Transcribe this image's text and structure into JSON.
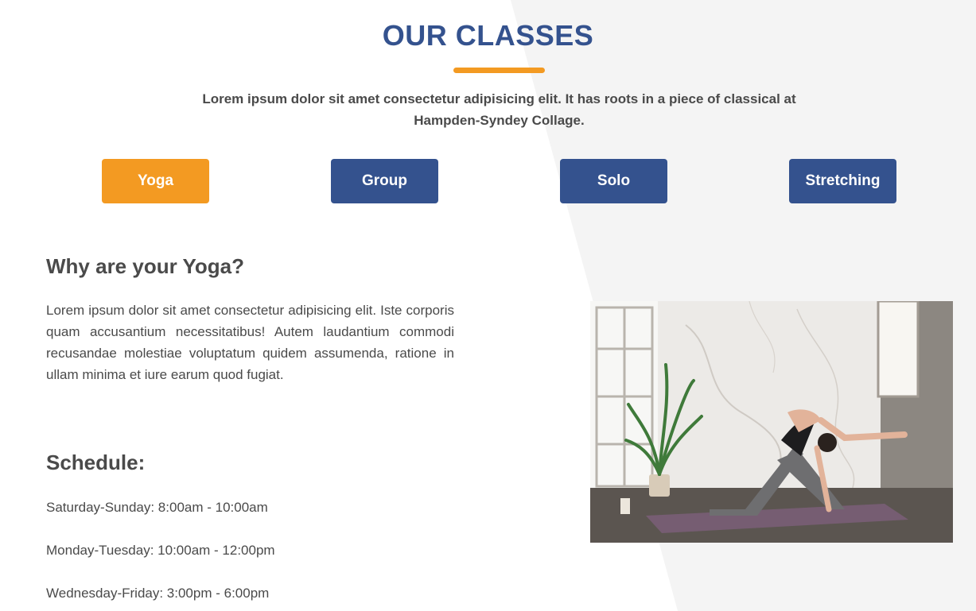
{
  "section": {
    "title": "OUR CLASSES",
    "intro": "Lorem ipsum dolor sit amet consectetur adipisicing elit. It has roots in a piece of classical at Hampden-Syndey Collage."
  },
  "tabs": [
    {
      "label": "Yoga",
      "active": true
    },
    {
      "label": "Group",
      "active": false
    },
    {
      "label": "Solo",
      "active": false
    },
    {
      "label": "Stretching",
      "active": false
    }
  ],
  "detail": {
    "heading": "Why are your Yoga?",
    "paragraph": "Lorem ipsum dolor sit amet consectetur adipisicing elit. Iste corporis quam accusantium necessitatibus! Autem laudantium commodi recusandae molestiae voluptatum quidem assumenda, ratione in ullam minima et iure earum quod fugiat.",
    "schedule_heading": "Schedule:",
    "schedule": [
      "Saturday-Sunday: 8:00am - 10:00am",
      "Monday-Tuesday: 10:00am - 12:00pm",
      "Wednesday-Friday: 3:00pm - 6:00pm"
    ]
  },
  "colors": {
    "primary": "#34528e",
    "accent": "#f39a22",
    "text": "#4a4a4a",
    "background_panel": "#f4f4f4"
  },
  "image": {
    "subject": "woman-doing-yoga-pose-photo"
  }
}
